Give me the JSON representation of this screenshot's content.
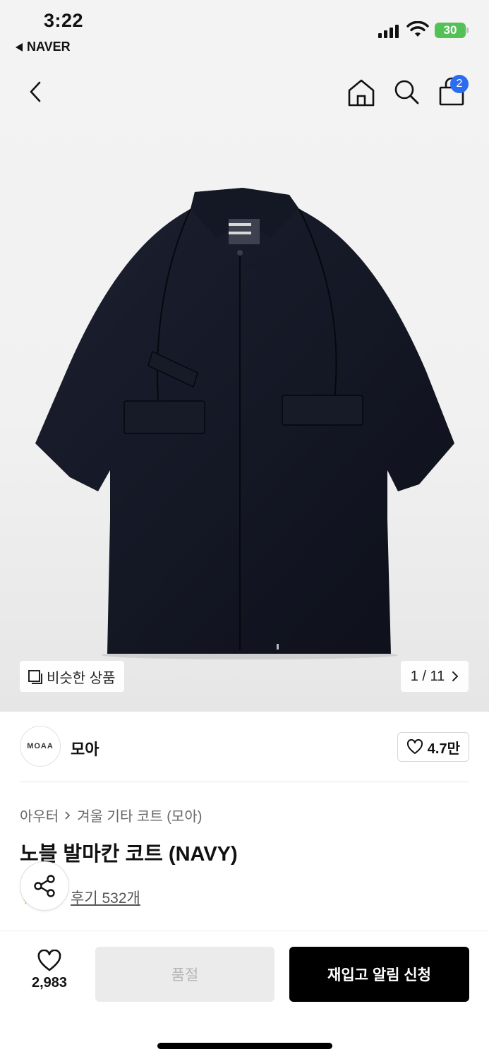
{
  "status": {
    "time": "3:22",
    "back_app": "NAVER",
    "battery": "30"
  },
  "nav": {
    "cart_count": "2"
  },
  "gallery": {
    "similar_label": "비슷한 상품",
    "page_current": "1",
    "page_separator": "/",
    "page_total": "11"
  },
  "brand": {
    "logo_text": "MOAA",
    "name": "모아",
    "like_count": "4.7만"
  },
  "product": {
    "breadcrumb": [
      "아우터",
      "겨울 기타 코트 (모아)"
    ],
    "title": "노블 발마칸 코트 (NAVY)",
    "reviews": "후기 532개"
  },
  "bottom": {
    "wish_count": "2,983",
    "soldout_label": "품절",
    "notify_label": "재입고 알림 신청"
  },
  "icons": {
    "back": "chevron-left-icon",
    "home": "home-icon",
    "search": "search-icon",
    "cart": "shopping-bag-icon",
    "share": "share-icon",
    "heart": "heart-icon",
    "similar": "copy-icon"
  },
  "colors": {
    "badge": "#2b6cf0",
    "battery": "#54c157",
    "cta": "#000000",
    "disabled": "#ebebeb"
  }
}
